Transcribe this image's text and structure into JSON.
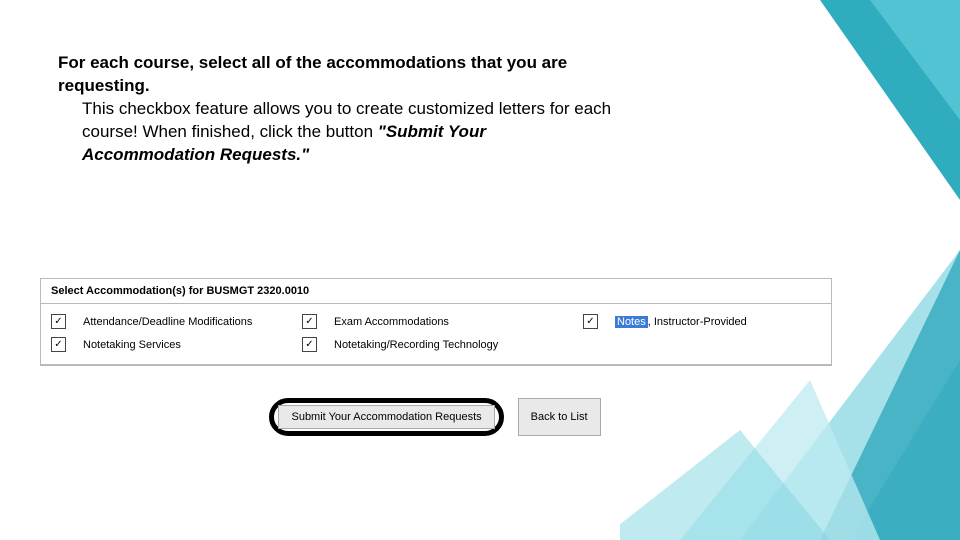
{
  "instruction": {
    "bold_lead": "For each course, select all of the accommodations that you are requesting.",
    "rest1": " This checkbox feature allows you to create customized letters for each course! When finished, click the button ",
    "quoted": "\"Submit Your Accommodation Requests.\""
  },
  "panel": {
    "header_prefix": "Select Accommodation(s) for ",
    "course_code": "BUSMGT 2320.0010",
    "items": {
      "r1c1": "Attendance/Deadline Modifications",
      "r1c2": "Exam Accommodations",
      "r1c3_hl": "Notes",
      "r1c3_rest": ", Instructor-Provided",
      "r2c1": "Notetaking Services",
      "r2c2": "Notetaking/Recording Technology"
    }
  },
  "buttons": {
    "submit": "Submit Your Accommodation Requests",
    "back": "Back to List"
  }
}
